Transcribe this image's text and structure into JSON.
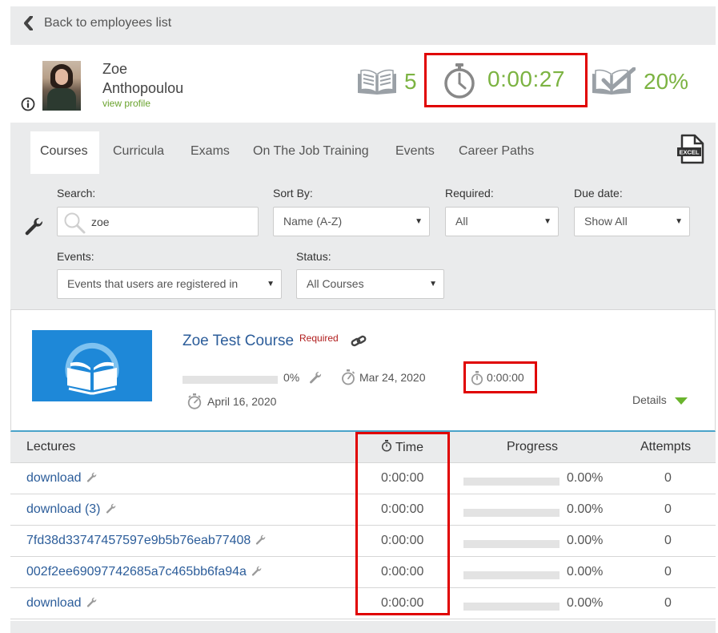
{
  "back_link": {
    "label": "Back to employees list"
  },
  "employee": {
    "first_name": "Zoe",
    "last_name": "Anthopoulou",
    "view_profile_label": "view profile"
  },
  "stats": {
    "courses_count": "5",
    "total_time": "0:00:27",
    "completion": "20%"
  },
  "tabs": [
    {
      "label": "Courses",
      "active": true
    },
    {
      "label": "Curricula",
      "active": false
    },
    {
      "label": "Exams",
      "active": false
    },
    {
      "label": "On The Job Training",
      "active": false
    },
    {
      "label": "Events",
      "active": false
    },
    {
      "label": "Career Paths",
      "active": false
    }
  ],
  "export": {
    "icon": "excel-icon",
    "label": "EXCEL"
  },
  "filters": {
    "search": {
      "label": "Search:",
      "value": "zoe"
    },
    "sort_by": {
      "label": "Sort By:",
      "value": "Name (A-Z)"
    },
    "required": {
      "label": "Required:",
      "value": "All"
    },
    "due_date": {
      "label": "Due date:",
      "value": "Show All"
    },
    "events": {
      "label": "Events:",
      "value": "Events that users are registered in"
    },
    "status": {
      "label": "Status:",
      "value": "All Courses"
    }
  },
  "course": {
    "title": "Zoe Test Course",
    "required_label": "Required",
    "progress_pct": "0%",
    "progress_value": 0,
    "start_date": "Mar 24, 2020",
    "time": "0:00:00",
    "completed_date": "April 16, 2020",
    "details_label": "Details"
  },
  "lectures": {
    "headers": {
      "name": "Lectures",
      "time": "Time",
      "progress": "Progress",
      "attempts": "Attempts"
    },
    "rows": [
      {
        "name": "download",
        "time": "0:00:00",
        "progress": "0.00%",
        "attempts": "0"
      },
      {
        "name": "download (3)",
        "time": "0:00:00",
        "progress": "0.00%",
        "attempts": "0"
      },
      {
        "name": "7fd38d33747457597e9b5b76eab77408",
        "time": "0:00:00",
        "progress": "0.00%",
        "attempts": "0"
      },
      {
        "name": "002f2ee69097742685a7c465bb6fa94a",
        "time": "0:00:00",
        "progress": "0.00%",
        "attempts": "0"
      },
      {
        "name": "download",
        "time": "0:00:00",
        "progress": "0.00%",
        "attempts": "0"
      }
    ]
  },
  "colors": {
    "accent_green": "#7cb342",
    "link_blue": "#2c5d9a",
    "highlight_red": "#e00000",
    "required_red": "#b01c1c"
  }
}
